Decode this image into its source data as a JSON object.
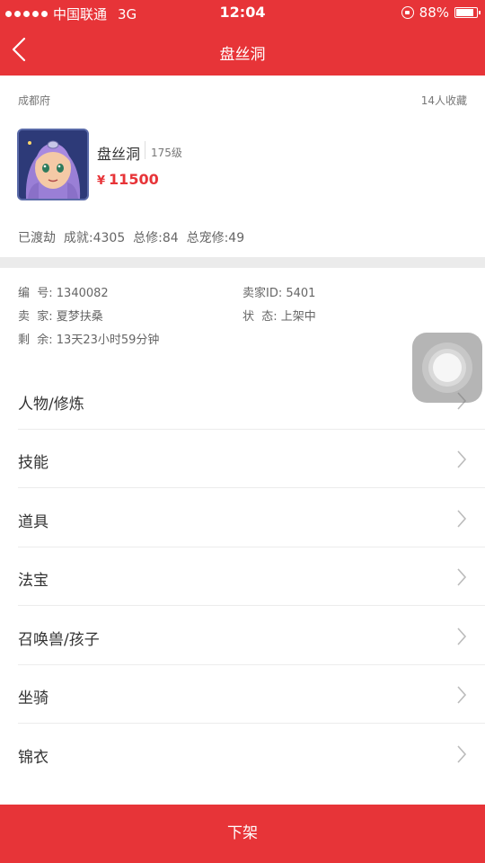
{
  "status_bar": {
    "carrier": "中国联通",
    "network": "3G",
    "time": "12:04",
    "battery": "88%",
    "battery_level": 0.88
  },
  "nav": {
    "title": "盘丝洞",
    "back_icon": "chevron-left-icon"
  },
  "listing": {
    "server": "成都府",
    "favorites": "14人收藏",
    "role_name": "盘丝洞",
    "level": "175级",
    "price_symbol": "¥",
    "price": "11500",
    "stats": "已渡劫  成就:4305  总修:84  总宠修:49"
  },
  "details": {
    "serial": "编  号: 1340082",
    "seller_id": "卖家ID: 5401",
    "seller": "卖  家: 夏梦扶桑",
    "status": "状  态: 上架中",
    "remaining": "剩  余: 13天23小时59分钟"
  },
  "menu": [
    {
      "label": "人物/修炼"
    },
    {
      "label": "技能"
    },
    {
      "label": "道具"
    },
    {
      "label": "法宝"
    },
    {
      "label": "召唤兽/孩子"
    },
    {
      "label": "坐骑"
    },
    {
      "label": "锦衣"
    }
  ],
  "bottom_button": {
    "label": "下架"
  },
  "colors": {
    "brand_red": "#e73438"
  }
}
